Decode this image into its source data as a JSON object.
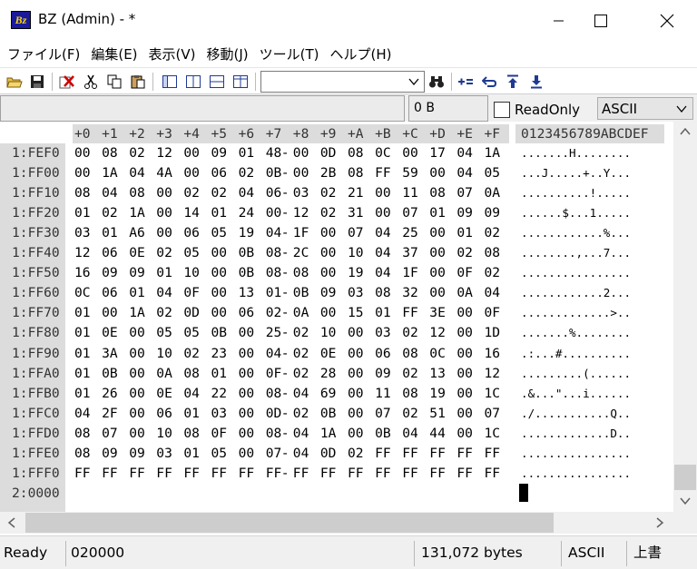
{
  "window": {
    "title": "BZ (Admin) -  *",
    "icon_text": "Bz",
    "buttons": [
      "minimize-icon",
      "maximize-icon",
      "close-icon"
    ]
  },
  "menu": [
    "ファイル(F)",
    "編集(E)",
    "表示(V)",
    "移動(J)",
    "ツール(T)",
    "ヘルプ(H)"
  ],
  "toolbar": {
    "buttons": [
      "open-folder-icon",
      "save-icon",
      "delete-icon",
      "cut-icon",
      "copy-icon",
      "paste-icon",
      "view-single-icon",
      "view-split-vertical-icon",
      "view-split-horizontal-icon",
      "view-compare-icon",
      "binoculars-icon",
      "add-equal-icon",
      "undo-arrow-icon",
      "jump-top-icon",
      "download-icon"
    ],
    "combo_value": ""
  },
  "infobar": {
    "size": "0 B",
    "readonly_label": "ReadOnly",
    "readonly_checked": false,
    "encoding": "ASCII"
  },
  "hex": {
    "columns": [
      "+0",
      "+1",
      "+2",
      "+3",
      "+4",
      "+5",
      "+6",
      "+7",
      "+8",
      "+9",
      "+A",
      "+B",
      "+C",
      "+D",
      "+E",
      "+F"
    ],
    "ascii_header": "0123456789ABCDEF",
    "rows": [
      {
        "addr": "1:FEF0",
        "bytes": [
          "00",
          "08",
          "02",
          "12",
          "00",
          "09",
          "01",
          "48",
          "00",
          "0D",
          "08",
          "0C",
          "00",
          "17",
          "04",
          "1A"
        ],
        "ascii": ". . . . . . . H . . . . . . . ."
      },
      {
        "addr": "1:FF00",
        "bytes": [
          "00",
          "1A",
          "04",
          "4A",
          "00",
          "06",
          "02",
          "0B",
          "00",
          "2B",
          "08",
          "FF",
          "59",
          "00",
          "04",
          "05"
        ],
        "ascii": ". . . J . . . . . + . . Y . . ."
      },
      {
        "addr": "1:FF10",
        "bytes": [
          "08",
          "04",
          "08",
          "00",
          "02",
          "02",
          "04",
          "06",
          "03",
          "02",
          "21",
          "00",
          "11",
          "08",
          "07",
          "0A"
        ],
        "ascii": ". . . . . . . . . . ! . . . . ."
      },
      {
        "addr": "1:FF20",
        "bytes": [
          "01",
          "02",
          "1A",
          "00",
          "14",
          "01",
          "24",
          "00",
          "12",
          "02",
          "31",
          "00",
          "07",
          "01",
          "09",
          "09"
        ],
        "ascii": ". . . . . . $ . . . 1 . . . . ."
      },
      {
        "addr": "1:FF30",
        "bytes": [
          "03",
          "01",
          "A6",
          "00",
          "06",
          "05",
          "19",
          "04",
          "1F",
          "00",
          "07",
          "04",
          "25",
          "00",
          "01",
          "02"
        ],
        "ascii": ". . . . . . . . . . . . % . . ."
      },
      {
        "addr": "1:FF40",
        "bytes": [
          "12",
          "06",
          "0E",
          "02",
          "05",
          "00",
          "0B",
          "08",
          "2C",
          "00",
          "10",
          "04",
          "37",
          "00",
          "02",
          "08"
        ],
        "ascii": ". . . . . . . . , . . . 7 . . ."
      },
      {
        "addr": "1:FF50",
        "bytes": [
          "16",
          "09",
          "09",
          "01",
          "10",
          "00",
          "0B",
          "08",
          "08",
          "00",
          "19",
          "04",
          "1F",
          "00",
          "0F",
          "02"
        ],
        "ascii": ". . . . . . . . . . . . . . . ."
      },
      {
        "addr": "1:FF60",
        "bytes": [
          "0C",
          "06",
          "01",
          "04",
          "0F",
          "00",
          "13",
          "01",
          "0B",
          "09",
          "03",
          "08",
          "32",
          "00",
          "0A",
          "04"
        ],
        "ascii": ". . . . . . . . . . . . 2 . . ."
      },
      {
        "addr": "1:FF70",
        "bytes": [
          "01",
          "00",
          "1A",
          "02",
          "0D",
          "00",
          "06",
          "02",
          "0A",
          "00",
          "15",
          "01",
          "FF",
          "3E",
          "00",
          "0F"
        ],
        "ascii": ". . . . . . . . . . . . . > . ."
      },
      {
        "addr": "1:FF80",
        "bytes": [
          "01",
          "0E",
          "00",
          "05",
          "05",
          "0B",
          "00",
          "25",
          "02",
          "10",
          "00",
          "03",
          "02",
          "12",
          "00",
          "1D"
        ],
        "ascii": ". . . . . . . % . . . . . . . ."
      },
      {
        "addr": "1:FF90",
        "bytes": [
          "01",
          "3A",
          "00",
          "10",
          "02",
          "23",
          "00",
          "04",
          "02",
          "0E",
          "00",
          "06",
          "08",
          "0C",
          "00",
          "16"
        ],
        "ascii": ". : . . . # . . . . . . . . . ."
      },
      {
        "addr": "1:FFA0",
        "bytes": [
          "01",
          "0B",
          "00",
          "0A",
          "08",
          "01",
          "00",
          "0F",
          "02",
          "28",
          "00",
          "09",
          "02",
          "13",
          "00",
          "12"
        ],
        "ascii": ". . . . . . . . . ( . . . . . ."
      },
      {
        "addr": "1:FFB0",
        "bytes": [
          "01",
          "26",
          "00",
          "0E",
          "04",
          "22",
          "00",
          "08",
          "04",
          "69",
          "00",
          "11",
          "08",
          "19",
          "00",
          "1C"
        ],
        "ascii": ". & . . . \" . . . i . . . . . ."
      },
      {
        "addr": "1:FFC0",
        "bytes": [
          "04",
          "2F",
          "00",
          "06",
          "01",
          "03",
          "00",
          "0D",
          "02",
          "0B",
          "00",
          "07",
          "02",
          "51",
          "00",
          "07"
        ],
        "ascii": ". / . . . . . . . . . . . Q . ."
      },
      {
        "addr": "1:FFD0",
        "bytes": [
          "08",
          "07",
          "00",
          "10",
          "08",
          "0F",
          "00",
          "08",
          "04",
          "1A",
          "00",
          "0B",
          "04",
          "44",
          "00",
          "1C"
        ],
        "ascii": ". . . . . . . . . . . . . D . ."
      },
      {
        "addr": "1:FFE0",
        "bytes": [
          "08",
          "09",
          "09",
          "03",
          "01",
          "05",
          "00",
          "07",
          "04",
          "0D",
          "02",
          "FF",
          "FF",
          "FF",
          "FF",
          "FF"
        ],
        "ascii": ". . . . . . . . . . . . . . . ."
      },
      {
        "addr": "1:FFF0",
        "bytes": [
          "FF",
          "FF",
          "FF",
          "FF",
          "FF",
          "FF",
          "FF",
          "FF",
          "FF",
          "FF",
          "FF",
          "FF",
          "FF",
          "FF",
          "FF",
          "FF"
        ],
        "ascii": ". . . . . . . . . . . . . . . ."
      },
      {
        "addr": "2:0000",
        "bytes": [],
        "ascii": ""
      }
    ]
  },
  "status": {
    "state": "Ready",
    "address": "020000",
    "size": "131,072 bytes",
    "encoding": "ASCII",
    "mode": "上書"
  }
}
